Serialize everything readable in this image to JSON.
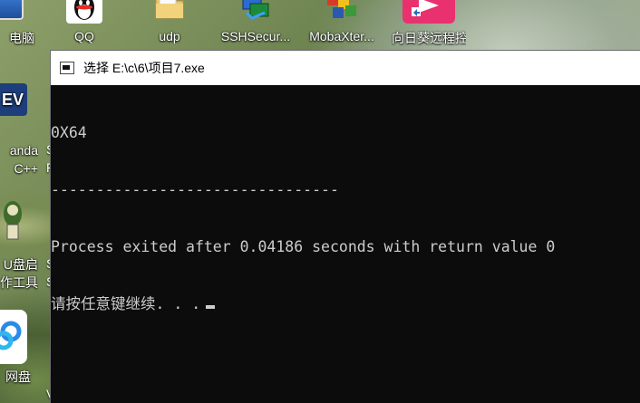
{
  "desktop": {
    "icons": [
      {
        "label": "电脑",
        "icon": "computer-icon"
      },
      {
        "label": "QQ",
        "icon": "qq-penguin-icon"
      },
      {
        "label": "udp",
        "icon": "folder-icon"
      },
      {
        "label": "SSHSecur...",
        "icon": "ssh-icon"
      },
      {
        "label": "MobaXter...",
        "icon": "mobaxterm-icon"
      },
      {
        "label": "向日葵远程控",
        "icon": "sunlogin-icon"
      },
      {
        "label_line1": "anda",
        "label_line2": "C++",
        "icon": "dev-cpp-icon",
        "badge": "EV"
      },
      {
        "label_line1": "U盘启",
        "label_line2": "作工具",
        "icon": "usb-tool-icon"
      },
      {
        "label": "网盘",
        "icon": "baidu-netdisk-icon"
      }
    ],
    "partial_labels": [
      "S",
      "F",
      "S",
      "S",
      "V"
    ]
  },
  "console": {
    "title": "选择 E:\\c\\6\\项目7.exe",
    "lines": [
      "0X64",
      "--------------------------------",
      "Process exited after 0.04186 seconds with return value 0",
      "请按任意键继续. . ."
    ]
  }
}
